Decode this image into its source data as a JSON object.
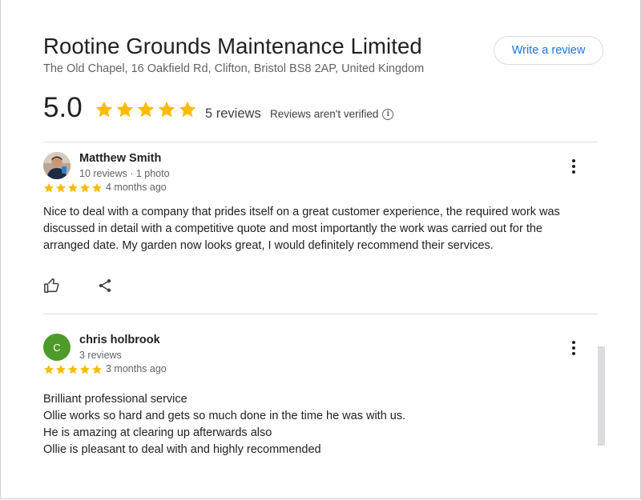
{
  "business": {
    "name": "Rootine Grounds Maintenance Limited",
    "address": "The Old Chapel, 16 Oakfield Rd, Clifton, Bristol BS8 2AP, United Kingdom",
    "write_review_label": "Write a review"
  },
  "summary": {
    "rating": "5.0",
    "stars": 5,
    "review_count": "5 reviews",
    "verification_note": "Reviews aren't verified",
    "star_color": "#fbbc04"
  },
  "reviews": [
    {
      "author": "Matthew Smith",
      "meta": "10 reviews · 1 photo",
      "avatar": "person-photo",
      "stars": 5,
      "date": "4 months ago",
      "lines": [
        "Nice to deal with a company that prides itself on a great customer experience, the required work was",
        "discussed in detail with a competitive quote and most importantly the work was carried out for the",
        "arranged date. My garden now looks great, I would definitely recommend their services."
      ],
      "actions": [
        "thumbs-up-icon",
        "share-icon"
      ]
    },
    {
      "author": "chris holbrook",
      "meta": "3 reviews",
      "avatar_letter": "C",
      "avatar_color": "#4e9a2a",
      "stars": 5,
      "date": "3 months ago",
      "lines": [
        "Brilliant professional service",
        "Ollie works so hard and gets so much done in the time he was with us.",
        "He is amazing at clearing up afterwards also",
        "Ollie is pleasant to deal with and highly recommended"
      ]
    }
  ],
  "colors": {
    "link_blue": "#1a73e8",
    "text_primary": "#202124",
    "text_secondary": "#5f6368"
  }
}
